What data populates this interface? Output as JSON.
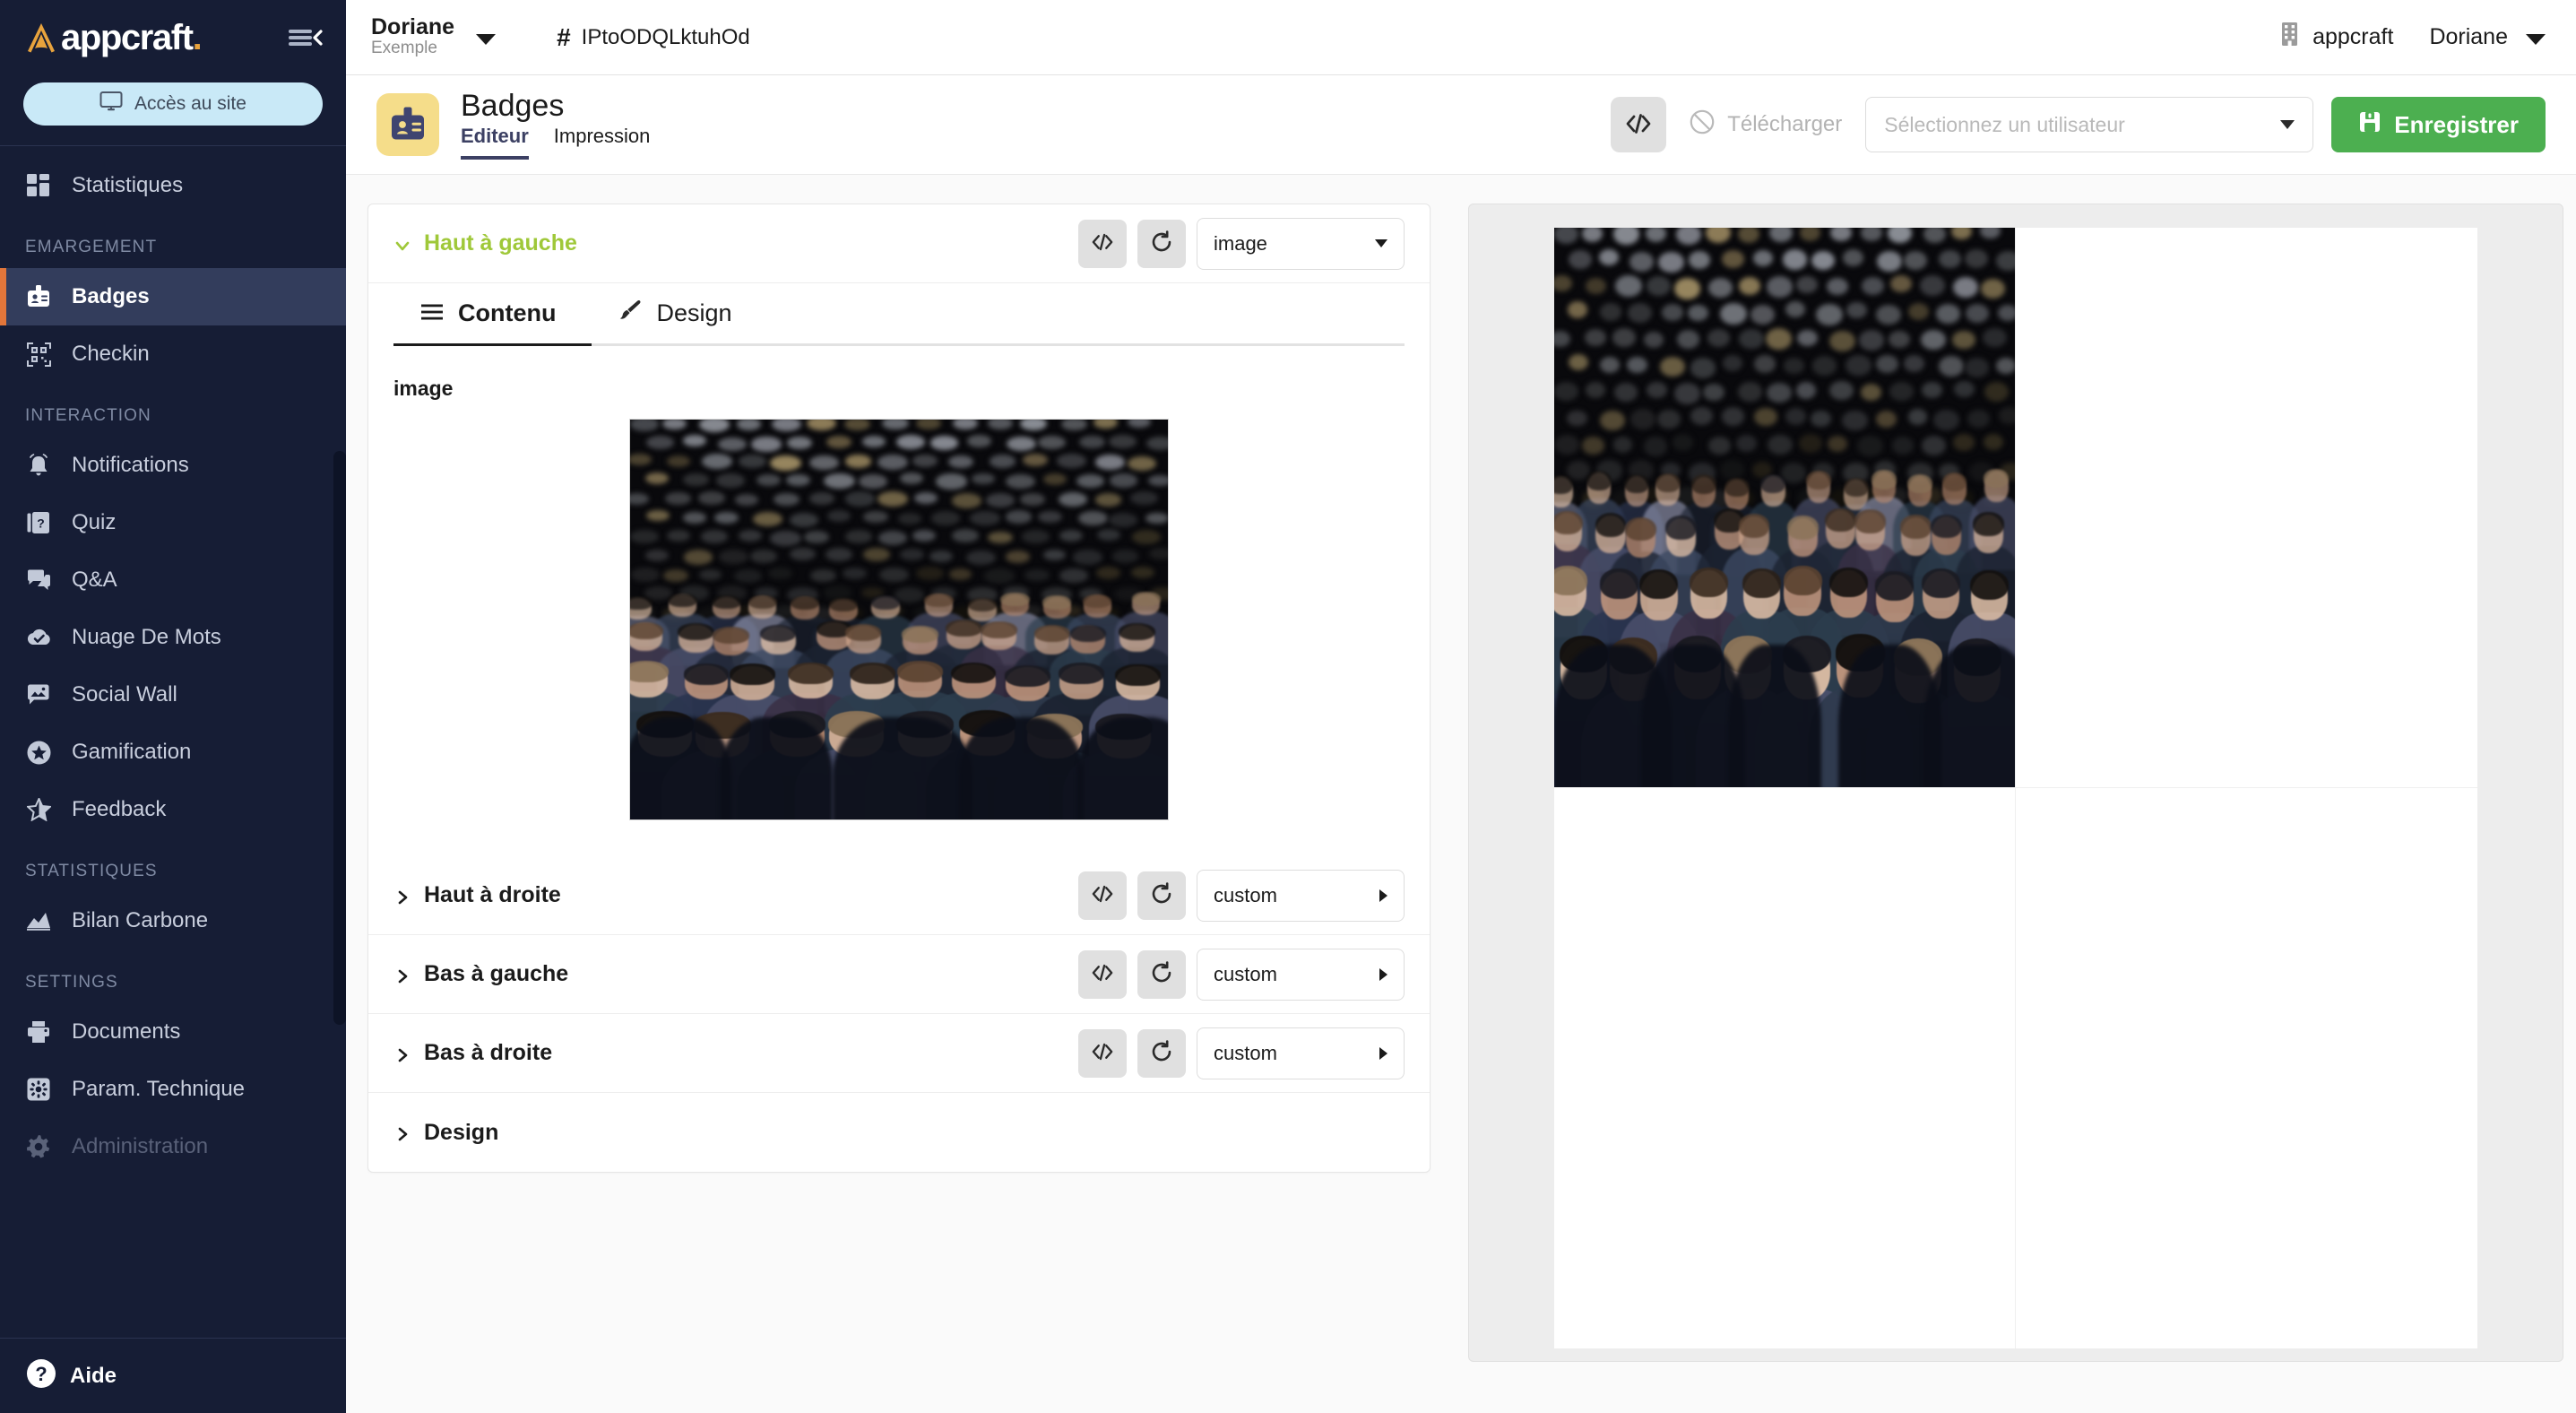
{
  "brand": {
    "name": "appcraft",
    "dot": ".",
    "logo_icon": "appcraft-logo-icon",
    "collapse_icon": "collapse-sidebar-icon"
  },
  "sidebar": {
    "access_button": {
      "label": "Accès au site",
      "icon": "monitor-icon"
    },
    "groups": [
      {
        "title": null,
        "items": [
          {
            "label": "Statistiques",
            "icon": "dashboard-icon",
            "active": false,
            "disabled": false
          }
        ]
      },
      {
        "title": "EMARGEMENT",
        "items": [
          {
            "label": "Badges",
            "icon": "badge-id-icon",
            "active": true,
            "disabled": false
          },
          {
            "label": "Checkin",
            "icon": "qrcode-icon",
            "active": false,
            "disabled": false
          }
        ]
      },
      {
        "title": "INTERACTION",
        "items": [
          {
            "label": "Notifications",
            "icon": "bell-icon",
            "active": false,
            "disabled": false
          },
          {
            "label": "Quiz",
            "icon": "quiz-card-icon",
            "active": false,
            "disabled": false
          },
          {
            "label": "Q&A",
            "icon": "chat-bubble-icon",
            "active": false,
            "disabled": false
          },
          {
            "label": "Nuage De Mots",
            "icon": "cloud-check-icon",
            "active": false,
            "disabled": false
          },
          {
            "label": "Social Wall",
            "icon": "photo-bubble-icon",
            "active": false,
            "disabled": false
          },
          {
            "label": "Gamification",
            "icon": "star-circle-icon",
            "active": false,
            "disabled": false
          },
          {
            "label": "Feedback",
            "icon": "star-half-icon",
            "active": false,
            "disabled": false
          }
        ]
      },
      {
        "title": "STATISTIQUES",
        "items": [
          {
            "label": "Bilan Carbone",
            "icon": "chart-mountain-icon",
            "active": false,
            "disabled": false
          }
        ]
      },
      {
        "title": "SETTINGS",
        "items": [
          {
            "label": "Documents",
            "icon": "printer-icon",
            "active": false,
            "disabled": false
          },
          {
            "label": "Param. Technique",
            "icon": "settings-square-icon",
            "active": false,
            "disabled": false
          },
          {
            "label": "Administration",
            "icon": "gear-icon",
            "active": false,
            "disabled": true
          }
        ]
      }
    ],
    "footer": {
      "label": "Aide",
      "icon": "help-circle-icon"
    }
  },
  "topbar": {
    "project_name": "Doriane",
    "project_sub": "Exemple",
    "project_caret_icon": "caret-down-icon",
    "hash_symbol": "#",
    "event_id": "IPtoODQLktuhOd",
    "org_label": "appcraft",
    "org_icon": "building-icon",
    "user_label": "Doriane",
    "user_caret_icon": "caret-down-icon"
  },
  "page": {
    "icon": "badge-id-icon",
    "title": "Badges",
    "tabs": [
      {
        "label": "Editeur",
        "active": true
      },
      {
        "label": "Impression",
        "active": false
      }
    ],
    "actions": {
      "code_button_icon": "code-brackets-icon",
      "download_label": "Télécharger",
      "download_icon": "forbidden-icon",
      "download_disabled": true,
      "user_select_placeholder": "Sélectionnez un utilisateur",
      "user_select_value": "",
      "user_select_caret_icon": "caret-down-icon",
      "save_label": "Enregistrer",
      "save_icon": "save-disk-icon",
      "save_color": "#4caf50"
    }
  },
  "editor": {
    "sections": [
      {
        "label": "Haut à gauche",
        "open": true,
        "chevron_icon": "chevron-down-icon",
        "code_icon": "code-brackets-icon",
        "refresh_icon": "refresh-icon",
        "select_value": "image",
        "select_caret_icon": "caret-down-icon",
        "content": {
          "tabs": [
            {
              "label": "Contenu",
              "icon": "list-lines-icon",
              "active": true
            },
            {
              "label": "Design",
              "icon": "paintbrush-icon",
              "active": false
            }
          ],
          "field_label": "image",
          "image_alt": "conference-audience-photo"
        }
      },
      {
        "label": "Haut à droite",
        "open": false,
        "chevron_icon": "chevron-right-icon",
        "code_icon": "code-brackets-icon",
        "refresh_icon": "refresh-icon",
        "select_value": "custom",
        "select_caret_icon": "caret-right-icon"
      },
      {
        "label": "Bas à gauche",
        "open": false,
        "chevron_icon": "chevron-right-icon",
        "code_icon": "code-brackets-icon",
        "refresh_icon": "refresh-icon",
        "select_value": "custom",
        "select_caret_icon": "caret-right-icon"
      },
      {
        "label": "Bas à droite",
        "open": false,
        "chevron_icon": "chevron-right-icon",
        "code_icon": "code-brackets-icon",
        "refresh_icon": "refresh-icon",
        "select_value": "custom",
        "select_caret_icon": "caret-right-icon"
      },
      {
        "label": "Design",
        "open": false,
        "chevron_icon": "chevron-right-icon",
        "select_value": null
      }
    ]
  },
  "preview": {
    "quadrants": [
      {
        "name": "top-left",
        "content": "conference-audience-photo"
      },
      {
        "name": "top-right",
        "content": ""
      },
      {
        "name": "bottom-left",
        "content": ""
      },
      {
        "name": "bottom-right",
        "content": ""
      }
    ]
  },
  "colors": {
    "sidebar_bg": "#161d35",
    "sidebar_active_bg": "#333d5c",
    "accent_orange": "#e2763a",
    "accent_green": "#9fc839",
    "save_green": "#4caf50",
    "badge_icon_bg": "#f5dd8a",
    "tab_purple": "#3c4063",
    "access_button_bg": "#c9e9f7"
  }
}
